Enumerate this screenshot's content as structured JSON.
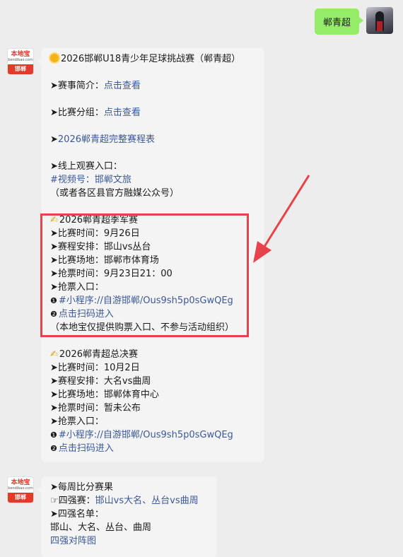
{
  "user_message": {
    "text": "郸青超"
  },
  "bot": {
    "logo_text": "本地宝",
    "logo_sub": "bendibao.com",
    "logo_city": "邯郸"
  },
  "message1": {
    "title": "2026邯郸U18青少年足球挑战赛（郸青超）",
    "intro_label": "➤赛事简介：",
    "intro_link": "点击查看",
    "group_label": "➤比赛分组：",
    "group_link": "点击查看",
    "arrow": "➤",
    "schedule_link": "2026郸青超完整赛程表",
    "watch_label": "➤线上观赛入口：",
    "channel_link": "#视频号：邯郸文旅",
    "channel_note": "（或者各区县官方融媒公众号）",
    "bronze": {
      "title": "2026郸青超季军赛",
      "time": "➤比赛时间：9月26日",
      "arrangement": "➤赛程安排：邯山vs丛台",
      "venue": "➤比赛场地：邯郸市体育场",
      "ticket_time": "➤抢票时间：9月23日21：00",
      "entry_label": "➤抢票入口：",
      "entry1_num": "❶",
      "entry1_link": "#小程序://自游邯郸/Ous9sh5p0sGwQEg",
      "entry2_num": "❷",
      "entry2_link": "点击扫码进入",
      "note": "（本地宝仅提供购票入口、不参与活动组织）"
    },
    "final": {
      "title": "2026郸青超总决赛",
      "time": "➤比赛时间：10月2日",
      "arrangement": "➤赛程安排：大名vs曲周",
      "venue": "➤比赛场地：邯郸体育中心",
      "ticket_time": "➤抢票时间：暂未公布",
      "entry_label": "➤抢票入口：",
      "entry1_num": "❶",
      "entry1_link": "#小程序://自游邯郸/Ous9sh5p0sGwQEg",
      "entry2_num": "❷",
      "entry2_link": "点击扫码进入"
    }
  },
  "message2": {
    "weekly": "➤每周比分赛果",
    "semi_label": "四强赛：",
    "semi_link": "邯山vs大名、丛台vs曲周",
    "top4_label": "➤四强名单：",
    "top4_list": "邯山、大名、丛台、曲周",
    "bracket_link": "四强对阵图"
  },
  "colors": {
    "link": "#3b5998",
    "highlight": "#e8424a",
    "bubble_green": "#95ec69"
  }
}
